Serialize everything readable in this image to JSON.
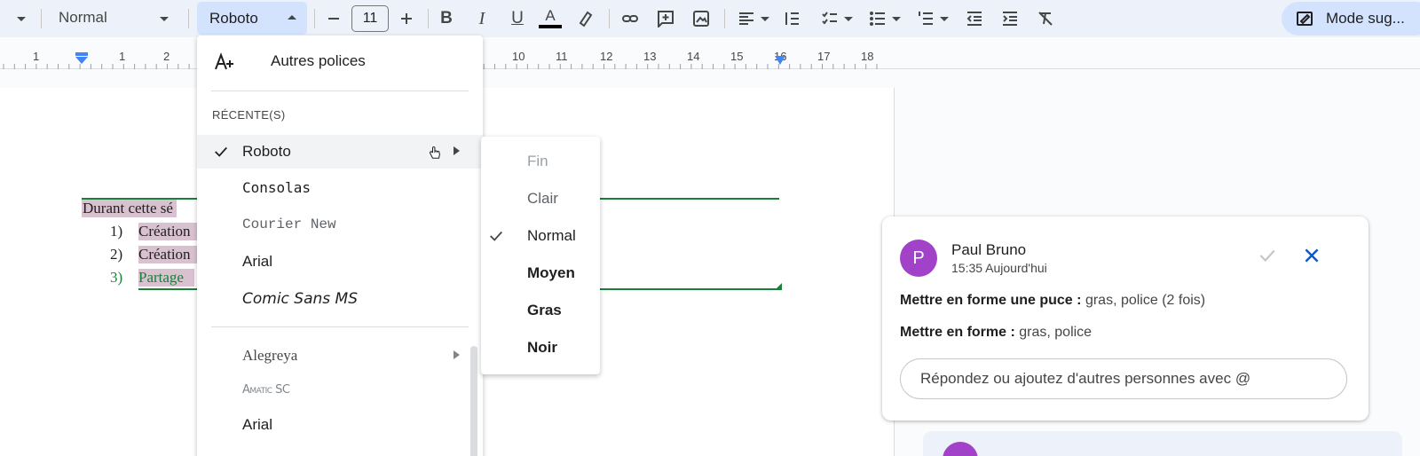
{
  "toolbar": {
    "style_select": "Normal",
    "font_select": "Roboto",
    "font_size": "11",
    "mode_button": "Mode sug..."
  },
  "ruler": {
    "numbers": [
      "1",
      "1",
      "2",
      "10",
      "11",
      "12",
      "13",
      "14",
      "15",
      "16",
      "17",
      "18"
    ]
  },
  "document": {
    "lines": [
      {
        "prefix": "",
        "text": "Durant cette sé"
      },
      {
        "prefix": "1)",
        "text": "Création"
      },
      {
        "prefix": "2)",
        "text": "Création"
      },
      {
        "prefix": "3)",
        "text": "Partage"
      }
    ]
  },
  "font_menu": {
    "more_fonts": "Autres polices",
    "recent_heading": "RÉCENTE(S)",
    "recent": [
      "Roboto",
      "Consolas",
      "Courier New",
      "Arial",
      "Comic Sans MS"
    ],
    "all": [
      "Alegreya",
      "Amatic SC",
      "Arial"
    ]
  },
  "weight_submenu": {
    "items": [
      "Fin",
      "Clair",
      "Normal",
      "Moyen",
      "Gras",
      "Noir"
    ],
    "selected": "Normal"
  },
  "comment": {
    "avatar_letter": "P",
    "author": "Paul Bruno",
    "time": "15:35 Aujourd'hui",
    "line1_label": "Mettre en forme une puce :",
    "line1_value": "gras, police (2 fois)",
    "line2_label": "Mettre en forme :",
    "line2_value": "gras, police",
    "reply_placeholder": "Répondez ou ajoutez d'autres personnes avec @"
  },
  "colors": {
    "accent": "#1a73e8",
    "selected_bg": "#d3e3fd",
    "avatar": "#a142c9",
    "suggestion_green": "#188038",
    "highlight": "#d9c2cf"
  }
}
